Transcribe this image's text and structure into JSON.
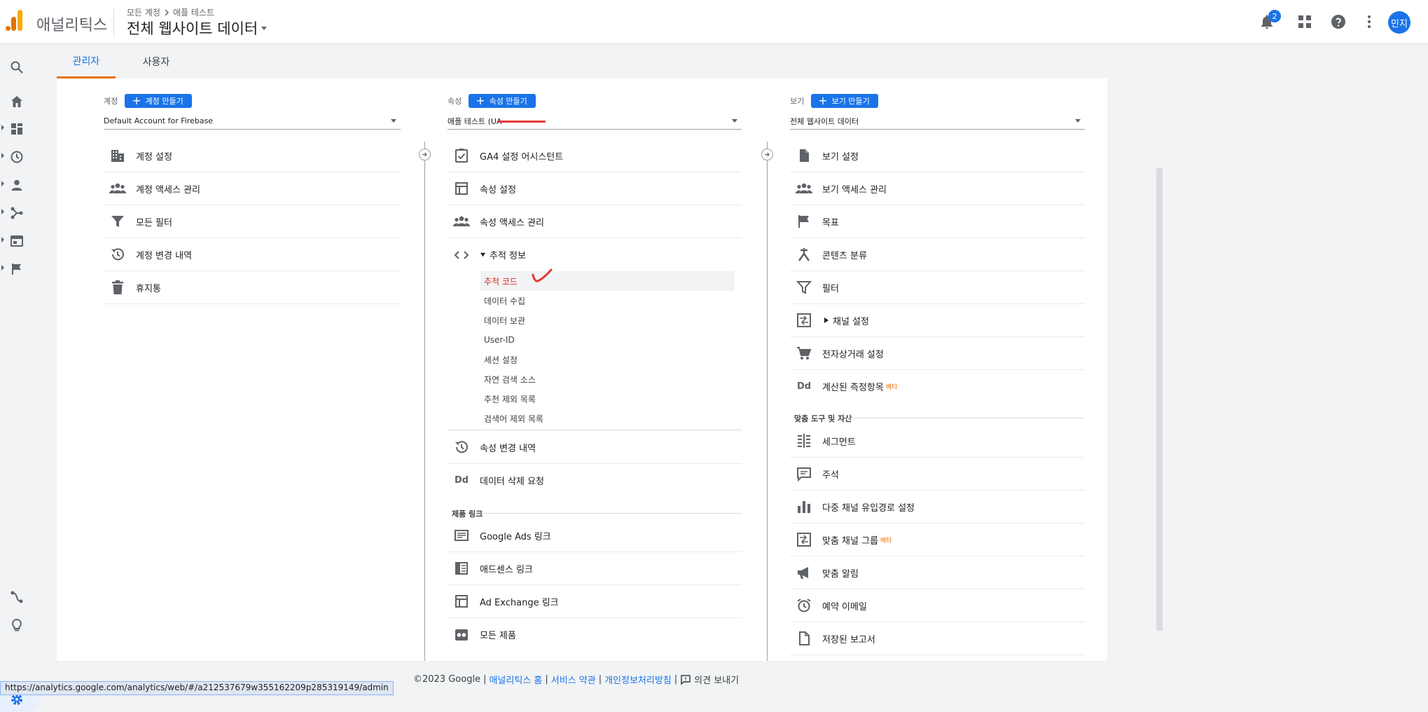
{
  "header": {
    "product_name": "애널리틱스",
    "breadcrumb_account": "모든 계정",
    "breadcrumb_property": "애플 테스트",
    "view_title": "전체 웹사이트 데이터",
    "notification_count": "2",
    "avatar_initials": "민지"
  },
  "tabs": {
    "admin": "관리자",
    "user": "사용자"
  },
  "account": {
    "label": "계정",
    "create_label": "계정 만들기",
    "selected": "Default Account for Firebase",
    "items": [
      {
        "label": "계정 설정",
        "icon": "building-icon"
      },
      {
        "label": "계정 액세스 관리",
        "icon": "people-icon"
      },
      {
        "label": "모든 필터",
        "icon": "filter-icon"
      },
      {
        "label": "계정 변경 내역",
        "icon": "history-icon"
      },
      {
        "label": "휴지통",
        "icon": "trash-icon"
      }
    ]
  },
  "property": {
    "label": "속성",
    "create_label": "속성 만들기",
    "selected": "애플 테스트 (UA-",
    "items": [
      {
        "label": "GA4 설정 어시스턴트",
        "icon": "checkbox-icon"
      },
      {
        "label": "속성 설정",
        "icon": "layout-icon"
      },
      {
        "label": "속성 액세스 관리",
        "icon": "people-icon"
      },
      {
        "label": "추적 정보",
        "icon": "code-icon"
      }
    ],
    "tracking_sub": [
      "추적 코드",
      "데이터 수집",
      "데이터 보관",
      "User-ID",
      "세션 설정",
      "자연 검색 소스",
      "추천 제외 목록",
      "검색어 제외 목록"
    ],
    "items2": [
      {
        "label": "속성 변경 내역",
        "icon": "history-icon"
      },
      {
        "label": "데이터 삭제 요청",
        "icon": "dd-icon"
      }
    ],
    "product_links_title": "제품 링크",
    "links": [
      {
        "label": "Google Ads 링크",
        "icon": "ads-icon"
      },
      {
        "label": "애드센스 링크",
        "icon": "adsense-icon"
      },
      {
        "label": "Ad Exchange 링크",
        "icon": "adexchange-icon"
      },
      {
        "label": "모든 제품",
        "icon": "products-icon"
      }
    ]
  },
  "view": {
    "label": "보기",
    "create_label": "보기 만들기",
    "selected": "전체 웹사이트 데이터",
    "items": [
      {
        "label": "보기 설정",
        "icon": "file-icon"
      },
      {
        "label": "보기 액세스 관리",
        "icon": "people-icon"
      },
      {
        "label": "목표",
        "icon": "flag-icon"
      },
      {
        "label": "콘텐츠 분류",
        "icon": "grouping-icon"
      },
      {
        "label": "필터",
        "icon": "filter-icon"
      },
      {
        "label": "채널 설정",
        "icon": "channel-icon"
      },
      {
        "label": "전자상거래 설정",
        "icon": "cart-icon"
      },
      {
        "label": "계산된 측정항목",
        "icon": "dd-icon",
        "beta": "베타"
      }
    ],
    "custom_tools_title": "맞춤 도구 및 자산",
    "tools": [
      {
        "label": "세그먼트",
        "icon": "segment-icon"
      },
      {
        "label": "주석",
        "icon": "comment-icon"
      },
      {
        "label": "다중 채널 유입경로 설정",
        "icon": "bar-chart-icon"
      },
      {
        "label": "맞춤 채널 그룹",
        "icon": "channel-icon",
        "beta": "베타"
      },
      {
        "label": "맞춤 알림",
        "icon": "megaphone-icon"
      },
      {
        "label": "예약 이메일",
        "icon": "alarm-icon"
      },
      {
        "label": "저장된 보고서",
        "icon": "document-icon"
      }
    ]
  },
  "footer": {
    "copyright": "©2023 Google",
    "sep": "|",
    "home_link": "애널리틱스 홈",
    "terms_link": "서비스 약관",
    "privacy_link": "개인정보처리방침",
    "feedback": "의견 보내기"
  },
  "status_url": "https://analytics.google.com/analytics/web/#/a212537679w355162209p285319149/admin",
  "colors": {
    "accent": "#1a73e8",
    "tab_underline": "#e8710a",
    "selected_red": "#d93025"
  }
}
